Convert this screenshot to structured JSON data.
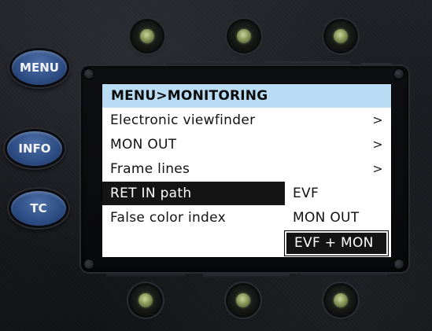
{
  "side_buttons": {
    "menu": "MENU",
    "info": "INFO",
    "tc": "TC"
  },
  "screen": {
    "title": "MENU>MONITORING",
    "menu_items": [
      {
        "label": "Electronic viewfinder",
        "arrow": ">"
      },
      {
        "label": "MON OUT",
        "arrow": ">"
      },
      {
        "label": "Frame lines",
        "arrow": ">"
      },
      {
        "label": "RET IN path",
        "arrow": ""
      },
      {
        "label": "False color index",
        "arrow": ""
      }
    ],
    "selected_item": "RET IN path",
    "submenu": {
      "options": [
        "EVF",
        "MON OUT",
        "EVF + MON"
      ],
      "selected": "EVF + MON"
    }
  },
  "colors": {
    "title_bar": "#b9dcf4",
    "selection": "#141414",
    "side_button_blue": "#2f4f86",
    "knob_led": "#8b975a"
  },
  "icons": {
    "knobs": "round-knob-button"
  }
}
